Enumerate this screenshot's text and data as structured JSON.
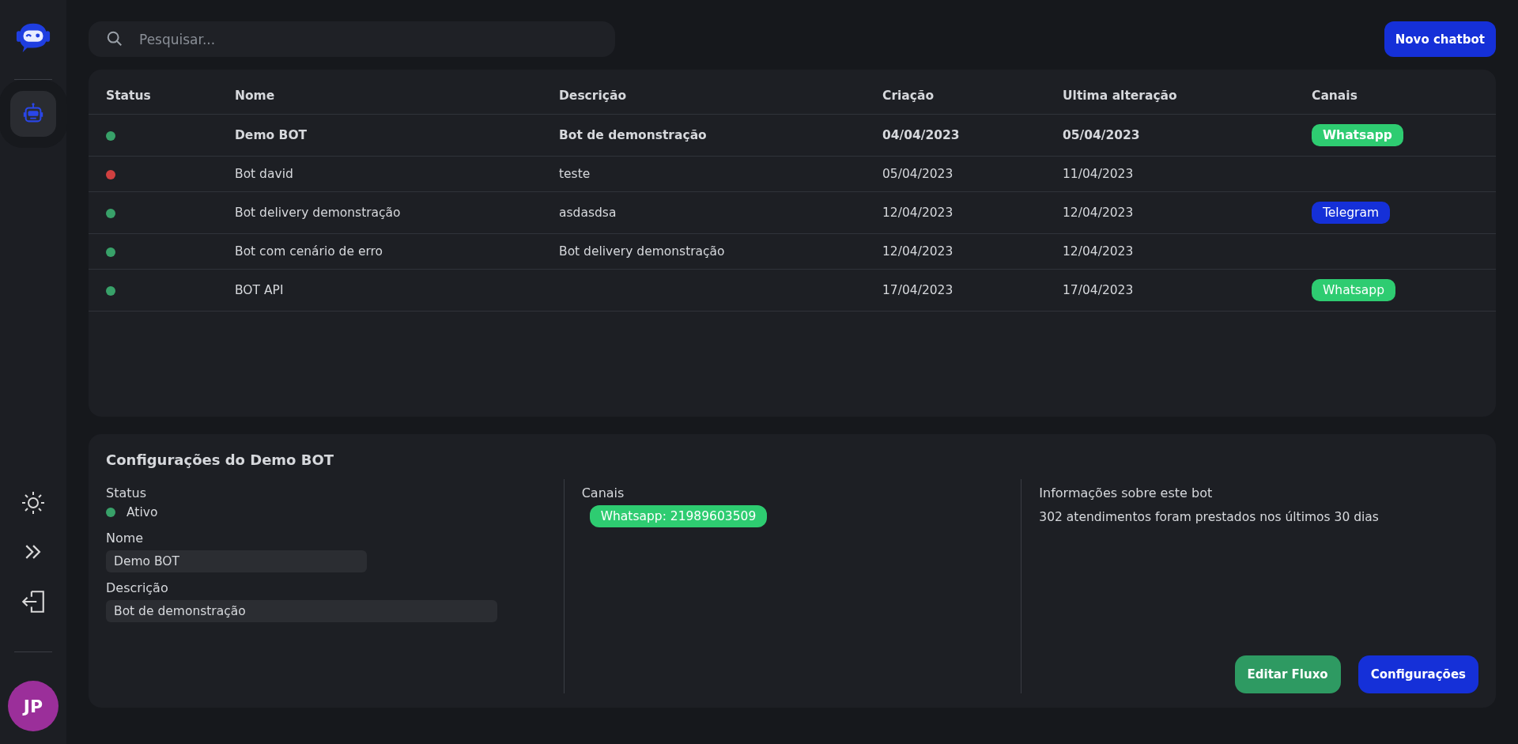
{
  "sidebar": {
    "nav_items": [
      {
        "selected": true
      }
    ],
    "avatar": {
      "initials": "JP"
    }
  },
  "search": {
    "placeholder": "Pesquisar..."
  },
  "new_button": "Novo chatbot",
  "table": {
    "columns": [
      "Status",
      "Nome",
      "Descrição",
      "Criação",
      "Ultima alteração",
      "Canais"
    ],
    "rows": [
      {
        "selected": true,
        "color": "#38a169",
        "name": "Demo BOT",
        "description": "Bot de demonstração",
        "created": "04/04/2023",
        "modified": "05/04/2023",
        "channels": [
          {
            "kind": "whatsapp",
            "label": "Whatsapp"
          }
        ]
      },
      {
        "selected": false,
        "color": "#d04040",
        "name": "Bot david",
        "description": "teste",
        "created": "05/04/2023",
        "modified": "11/04/2023",
        "channels": []
      },
      {
        "selected": false,
        "color": "#38a169",
        "name": "Bot delivery demonstração",
        "description": "asdasdsa",
        "created": "12/04/2023",
        "modified": "12/04/2023",
        "channels": [
          {
            "kind": "telegram",
            "label": "Telegram"
          }
        ]
      },
      {
        "selected": false,
        "color": "#38a169",
        "name": "Bot com cenário de erro",
        "description": "Bot delivery demonstração",
        "created": "12/04/2023",
        "modified": "12/04/2023",
        "channels": []
      },
      {
        "selected": false,
        "color": "#38a169",
        "name": "BOT API",
        "description": "",
        "created": "17/04/2023",
        "modified": "17/04/2023",
        "channels": [
          {
            "kind": "whatsapp",
            "label": "Whatsapp"
          }
        ]
      }
    ]
  },
  "details": {
    "title": "Configurações do Demo BOT",
    "status": {
      "label": "Status",
      "color": "#38a169",
      "value": "Ativo"
    },
    "name_label": "Nome",
    "name_value": "Demo BOT",
    "description_label": "Descrição",
    "description_value": "Bot de demonstração",
    "channels_label": "Canais",
    "channels": [
      {
        "kind": "whatsapp",
        "label": "Whatsapp: 21989603509"
      }
    ],
    "info_label": "Informações sobre este bot",
    "info_text": "302 atendimentos foram prestados nos últimos 30 dias",
    "buttons": [
      {
        "kind": "success",
        "label": "Editar Fluxo"
      },
      {
        "kind": "primary",
        "label": "Configurações"
      }
    ]
  }
}
